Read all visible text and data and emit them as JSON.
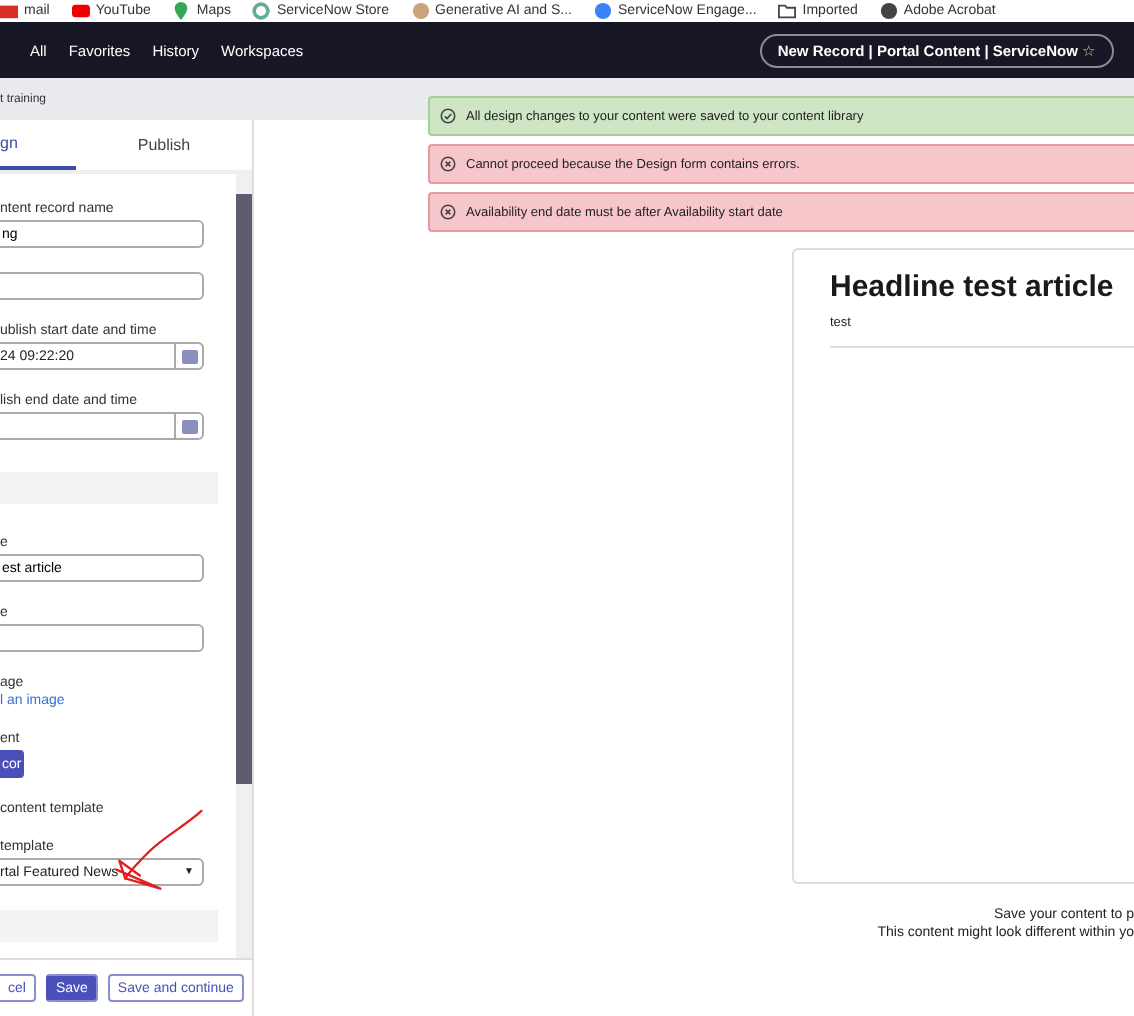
{
  "bookmarks": [
    {
      "label": "mail"
    },
    {
      "label": "YouTube"
    },
    {
      "label": "Maps"
    },
    {
      "label": "ServiceNow Store"
    },
    {
      "label": "Generative AI and S..."
    },
    {
      "label": "ServiceNow Engage..."
    },
    {
      "label": "Imported"
    },
    {
      "label": "Adobe Acrobat"
    }
  ],
  "nav": {
    "items": [
      "All",
      "Favorites",
      "History",
      "Workspaces"
    ],
    "record_title": "New Record | Portal Content | ServiceNow",
    "star": "☆"
  },
  "breadcrumb": "t training",
  "tabs": [
    {
      "label": "gn",
      "selected": true
    },
    {
      "label": "Publish",
      "selected": false
    }
  ],
  "form": [
    {
      "kind": "field",
      "label": "ntent record name",
      "value": "ng"
    },
    {
      "kind": "field"
    },
    {
      "kind": "date",
      "label": "ublish start date and time",
      "value": "24 09:22:20"
    },
    {
      "kind": "date",
      "label": "lish end date and time"
    },
    {
      "kind": "section"
    },
    {
      "kind": "field",
      "label": "e",
      "value": "est article"
    },
    {
      "kind": "field",
      "label": "e"
    },
    {
      "kind": "link",
      "label": "age",
      "link": "l an image"
    },
    {
      "kind": "button",
      "label": "ent",
      "button": "cor"
    },
    {
      "kind": "text",
      "label": "content template"
    },
    {
      "kind": "select",
      "label": "template",
      "value": "rtal Featured News",
      "caret": "▼"
    }
  ],
  "footer_buttons": [
    {
      "label": "cel",
      "primary": false
    },
    {
      "label": "Save",
      "primary": true
    },
    {
      "label": "Save and continue",
      "primary": false
    }
  ],
  "alerts": [
    {
      "kind": "success",
      "text": "All design changes to your content were saved to your content library"
    },
    {
      "kind": "error",
      "text": "Cannot proceed because the Design form contains errors."
    },
    {
      "kind": "error",
      "text": "Availability end date must be after Availability start date"
    }
  ],
  "preview": {
    "headline": "Headline test article",
    "body": "test"
  },
  "notes": [
    "Save your content to p",
    "This content might look different within yo"
  ]
}
